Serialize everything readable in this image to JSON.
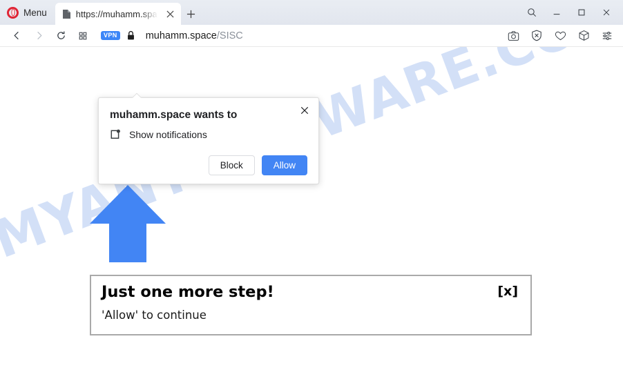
{
  "browser": {
    "menu_label": "Menu",
    "opera_logo_color": "#e02535",
    "tab": {
      "title": "https://muhamm.spa",
      "favicon": "page-icon",
      "close": "✕"
    },
    "new_tab": "+",
    "window_controls": {
      "search": "search-icon",
      "minimize": "minimize-icon",
      "maximize": "maximize-icon",
      "close": "close-icon"
    },
    "toolbar": {
      "back": "back-arrow-icon",
      "forward": "forward-arrow-icon",
      "reload": "reload-icon",
      "speeddial": "speed-dial-icon",
      "vpn_badge": "VPN",
      "lock": "lock-icon",
      "url_host": "muhamm.space",
      "url_path": "/SISC",
      "right_icons": [
        "snapshot-icon",
        "ad-blocker-shield-icon",
        "heart-icon",
        "cube-icon",
        "easy-setup-sliders-icon"
      ]
    }
  },
  "permission_dialog": {
    "title": "muhamm.space wants to",
    "permission_icon": "notification-badge-icon",
    "permission_text": "Show notifications",
    "block_label": "Block",
    "allow_label": "Allow",
    "close_label": "✕",
    "allow_color": "#4285f4"
  },
  "page": {
    "watermark": "MYANTISPYWARE.COM",
    "watermark_color": "#d3e0f7",
    "arrow": {
      "name": "blue-up-arrow",
      "color": "#4285f4"
    },
    "content_box": {
      "title": "Just one more step!",
      "subtitle": "'Allow' to continue",
      "close_label": "[x]"
    }
  }
}
